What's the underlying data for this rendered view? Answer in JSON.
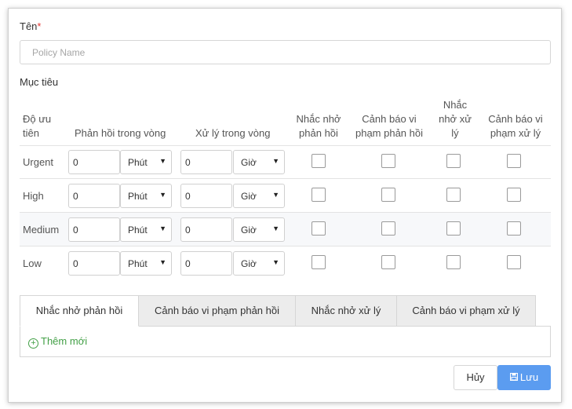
{
  "form": {
    "name_label": "Tên",
    "required_mark": "*",
    "name_placeholder": "Policy Name",
    "target_label": "Mục tiêu"
  },
  "table": {
    "headers": {
      "priority": [
        "Độ ưu",
        "tiên"
      ],
      "response": "Phản hồi trong vòng",
      "resolve": "Xử lý trong vòng",
      "remind_response": [
        "Nhắc nhở",
        "phản hồi"
      ],
      "warn_response": [
        "Cảnh báo vi",
        "phạm phản hồi"
      ],
      "remind_resolve": [
        "Nhắc",
        "nhở xử",
        "lý"
      ],
      "warn_resolve": [
        "Cảnh báo vi",
        "phạm xử lý"
      ]
    },
    "rows": [
      {
        "priority": "Urgent",
        "response_value": "0",
        "response_unit": "Phút",
        "resolve_value": "0",
        "resolve_unit": "Giờ"
      },
      {
        "priority": "High",
        "response_value": "0",
        "response_unit": "Phút",
        "resolve_value": "0",
        "resolve_unit": "Giờ"
      },
      {
        "priority": "Medium",
        "response_value": "0",
        "response_unit": "Phút",
        "resolve_value": "0",
        "resolve_unit": "Giờ"
      },
      {
        "priority": "Low",
        "response_value": "0",
        "response_unit": "Phút",
        "resolve_value": "0",
        "resolve_unit": "Giờ"
      }
    ]
  },
  "tabs": [
    "Nhắc nhở phản hồi",
    "Cảnh báo vi phạm phản hồi",
    "Nhắc nhở xử lý",
    "Cảnh báo vi phạm xử lý"
  ],
  "add_new_label": "Thêm mới",
  "buttons": {
    "cancel": "Hủy",
    "save": "Lưu"
  },
  "icons": {
    "add": "plus-circle-icon",
    "save": "floppy-disk-icon",
    "dropdown": "caret-down-icon"
  },
  "colors": {
    "primary": "#5b9cf0",
    "add_link": "#43a047",
    "required": "#e53935"
  }
}
